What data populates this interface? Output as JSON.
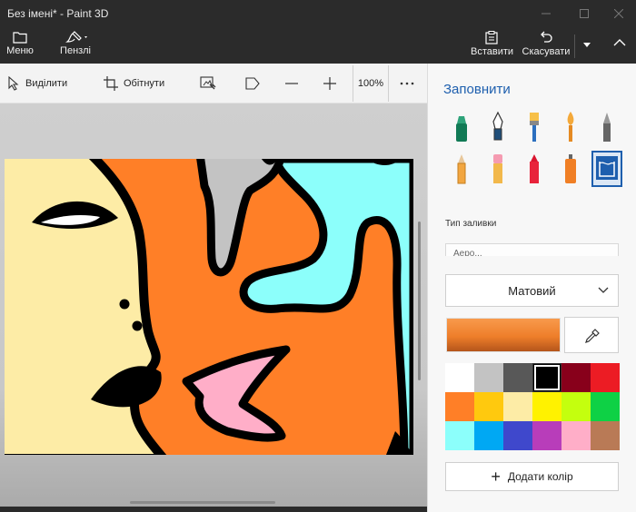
{
  "window": {
    "title": "Без імені* - Paint 3D"
  },
  "commandbar": {
    "menu_label": "Меню",
    "brushes_label": "Пензлі",
    "paste_label": "Вставити",
    "undo_label": "Скасувати"
  },
  "toolbar": {
    "select_label": "Виділити",
    "crop_label": "Обітнути",
    "zoom_value": "100%"
  },
  "panel": {
    "title": "Заповнити",
    "fill_type_label": "Тип заливки",
    "fill_type_value": "Аеро...",
    "material_value": "Матовий",
    "current_color": "#f08a32",
    "add_color_label": "Додати колір",
    "brushes": [
      "marker",
      "calligraphy-pen",
      "oil-brush",
      "watercolor",
      "pixel-pen",
      "pencil",
      "eraser",
      "crayon",
      "spray-can",
      "fill"
    ],
    "palette": [
      "#ffffff",
      "#c3c3c3",
      "#585858",
      "#000000",
      "#88001b",
      "#ec1c24",
      "#ff7f27",
      "#ffc90e",
      "#fdeca6",
      "#fff200",
      "#c4ff0e",
      "#0ed145",
      "#8cfffb",
      "#00a8f3",
      "#3f48cc",
      "#b83dba",
      "#ffaec8",
      "#b97a56"
    ]
  }
}
